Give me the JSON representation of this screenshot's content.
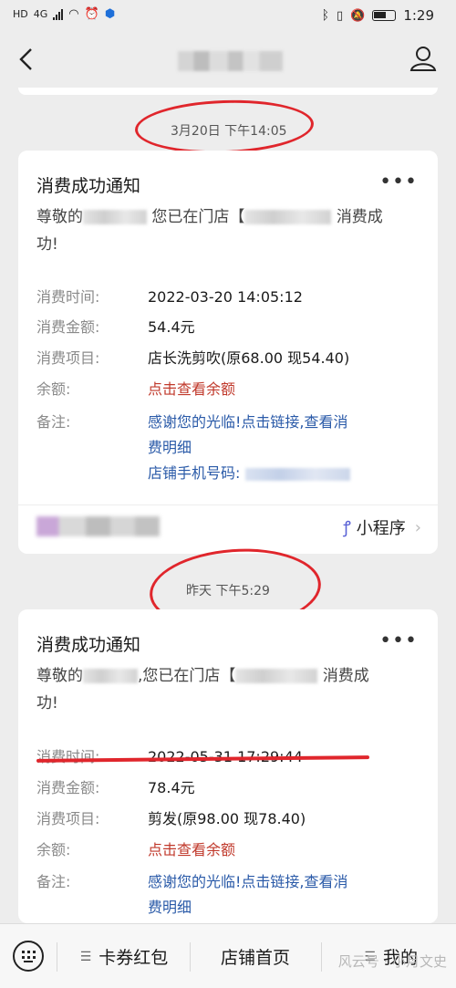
{
  "status_bar": {
    "network_left": "HD",
    "network_type": "4G",
    "time": "1:29"
  },
  "card1": {
    "time_label": "3月20日 下午14:05",
    "title": "消费成功通知",
    "greeting_prefix": "尊敬的",
    "greeting_mid": "您已在门店【",
    "greeting_suffix": "消费成",
    "greeting_end": "功!",
    "rows": [
      {
        "key": "消费时间:",
        "value": "2022-03-20 14:05:12"
      },
      {
        "key": "消费金额:",
        "value": "54.4元"
      },
      {
        "key": "消费项目:",
        "value": "店长洗剪吹(原68.00 现54.40)"
      },
      {
        "key": "余额:",
        "value": "点击查看余额"
      },
      {
        "key": "备注:",
        "value": "感谢您的光临!点击链接,查看消"
      }
    ],
    "remark_line2": "费明细",
    "remark_line3": "店铺手机号码:",
    "mini_program": "小程序"
  },
  "card2": {
    "time_label": "昨天 下午5:29",
    "title": "消费成功通知",
    "greeting_prefix": "尊敬的",
    "greeting_mid": ",您已在门店【",
    "greeting_suffix": "消费成",
    "greeting_end": "功!",
    "rows": [
      {
        "key": "消费时间:",
        "value": "2022-05-31 17:29:44"
      },
      {
        "key": "消费金额:",
        "value": "78.4元"
      },
      {
        "key": "消费项目:",
        "value": "剪发(原98.00 现78.40)"
      },
      {
        "key": "余额:",
        "value": "点击查看余额"
      },
      {
        "key": "备注:",
        "value": "感谢您的光临!点击链接,查看消"
      }
    ],
    "remark_line2": "费明细"
  },
  "bottom_menu": {
    "item1": "卡券红包",
    "item2": "店铺首页",
    "item3": "我的"
  },
  "watermark": "风云号 · 小月文史",
  "colors": {
    "annotation_red": "#e0262c",
    "link_blue": "#2a5aa8",
    "balance_red": "#c0392b"
  }
}
